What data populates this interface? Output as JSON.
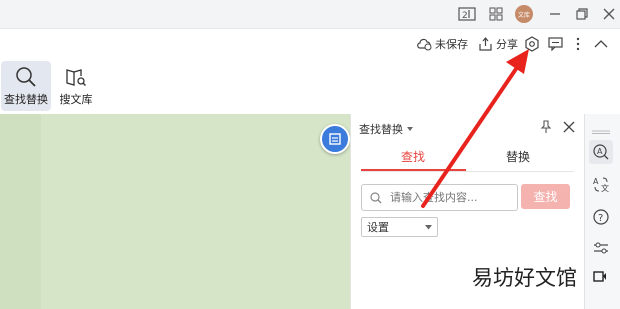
{
  "titlebar": {
    "avatar_label": "文库",
    "icons": [
      "reader-mode-icon",
      "fullscreen-icon",
      "apps-grid-icon",
      "minimize-icon",
      "restore-icon",
      "close-icon"
    ]
  },
  "command_bar": {
    "unsaved_label": "未保存",
    "share_label": "分享",
    "tools": [
      {
        "label": "查找替换",
        "icon": "magnifier-icon",
        "active": true
      },
      {
        "label": "搜文库",
        "icon": "book-search-icon",
        "active": false
      }
    ]
  },
  "panel": {
    "title": "查找替换",
    "tabs": [
      {
        "label": "查找",
        "active": true
      },
      {
        "label": "替换",
        "active": false
      }
    ],
    "search": {
      "placeholder": "请输入查找内容...",
      "value": ""
    },
    "find_button": "查找",
    "settings": {
      "selected": "设置"
    }
  },
  "side_strip": {
    "icons": [
      "text-check-icon",
      "translate-icon",
      "help-icon",
      "sliders-icon"
    ]
  },
  "watermark": "易坊好文馆",
  "colors": {
    "accent": "#e8433e",
    "find_button_disabled": "#f5b3b0",
    "document_bg": "#d6e5c8",
    "float_button": "#3a7bdc",
    "arrow": "#e8231e"
  }
}
